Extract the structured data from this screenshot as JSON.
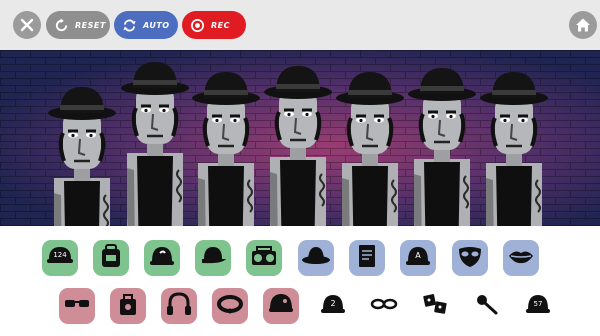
{
  "toolbar": {
    "reset_label": "RESET",
    "auto_label": "AUTO",
    "rec_label": "REC",
    "icons": {
      "close": "close-icon",
      "reset": "reset-icon",
      "auto": "auto-icon",
      "rec": "record-icon",
      "home": "home-icon"
    }
  },
  "colors": {
    "beats": "#7fc38f",
    "effects": "#9fb1d6",
    "melodies": "#cf8d98",
    "rec": "#e01b22",
    "auto": "#4d6ec0"
  },
  "stage": {
    "performer_count": 7
  },
  "palette": {
    "row1": [
      {
        "icon": "cap-124-icon",
        "group": "green"
      },
      {
        "icon": "backpack-icon",
        "group": "green"
      },
      {
        "icon": "cap-ear-icon",
        "group": "green"
      },
      {
        "icon": "cap-visor-icon",
        "group": "green"
      },
      {
        "icon": "boombox-icon",
        "group": "green"
      },
      {
        "icon": "fedora-icon",
        "group": "blue"
      },
      {
        "icon": "notebook-icon",
        "group": "blue"
      },
      {
        "icon": "cap-a-icon",
        "group": "blue"
      },
      {
        "icon": "mask-icon",
        "group": "blue"
      },
      {
        "icon": "lips-icon",
        "group": "blue"
      }
    ],
    "row2": [
      {
        "icon": "sunglasses-icon",
        "group": "red"
      },
      {
        "icon": "bag-icon",
        "group": "red"
      },
      {
        "icon": "headphones-icon",
        "group": "red"
      },
      {
        "icon": "collar-icon",
        "group": "red"
      },
      {
        "icon": "helmet-icon",
        "group": "red"
      },
      {
        "icon": "cap-2-icon",
        "group": "plain"
      },
      {
        "icon": "glasses-icon",
        "group": "plain"
      },
      {
        "icon": "dice-icon",
        "group": "plain"
      },
      {
        "icon": "microphone-icon",
        "group": "plain"
      },
      {
        "icon": "cap-57-icon",
        "group": "plain"
      }
    ]
  }
}
